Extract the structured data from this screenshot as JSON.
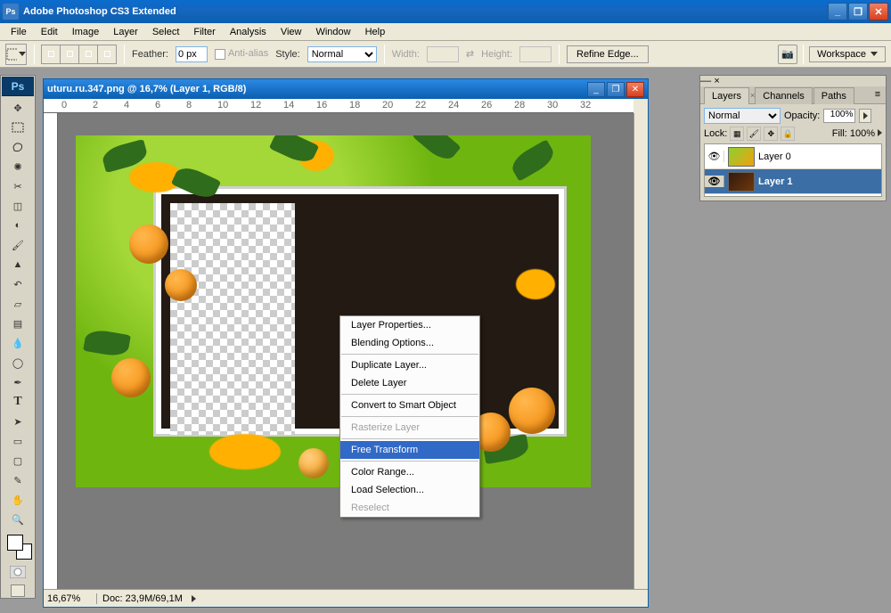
{
  "app": {
    "title": "Adobe Photoshop CS3 Extended"
  },
  "menu": [
    "File",
    "Edit",
    "Image",
    "Layer",
    "Select",
    "Filter",
    "Analysis",
    "View",
    "Window",
    "Help"
  ],
  "options": {
    "feather_label": "Feather:",
    "feather_value": "0 px",
    "antialias_label": "Anti-alias",
    "style_label": "Style:",
    "style_value": "Normal",
    "width_label": "Width:",
    "height_label": "Height:",
    "refine_label": "Refine Edge...",
    "workspace_label": "Workspace"
  },
  "document": {
    "title": "uturu.ru.347.png @ 16,7% (Layer 1, RGB/8)",
    "zoom": "16,67%",
    "docsize": "Doc: 23,9M/69,1M",
    "ruler_marks": [
      "0",
      "2",
      "4",
      "6",
      "8",
      "10",
      "12",
      "14",
      "16",
      "18",
      "20",
      "22",
      "24",
      "26",
      "28",
      "30",
      "32"
    ]
  },
  "context_menu": {
    "items": [
      {
        "label": "Layer Properties...",
        "enabled": true
      },
      {
        "label": "Blending Options...",
        "enabled": true
      },
      {
        "sep": true
      },
      {
        "label": "Duplicate Layer...",
        "enabled": true
      },
      {
        "label": "Delete Layer",
        "enabled": true
      },
      {
        "sep": true
      },
      {
        "label": "Convert to Smart Object",
        "enabled": true
      },
      {
        "sep": true
      },
      {
        "label": "Rasterize Layer",
        "enabled": false
      },
      {
        "sep": true
      },
      {
        "label": "Free Transform",
        "enabled": true,
        "selected": true
      },
      {
        "sep": true
      },
      {
        "label": "Color Range...",
        "enabled": true
      },
      {
        "label": "Load Selection...",
        "enabled": true
      },
      {
        "label": "Reselect",
        "enabled": false
      }
    ]
  },
  "layers_panel": {
    "tabs": [
      "Layers",
      "Channels",
      "Paths"
    ],
    "blend_mode": "Normal",
    "opacity_label": "Opacity:",
    "opacity_value": "100%",
    "lock_label": "Lock:",
    "fill_label": "Fill:",
    "fill_value": "100%",
    "layers": [
      {
        "name": "Layer 0",
        "visible": true,
        "selected": false
      },
      {
        "name": "Layer 1",
        "visible": true,
        "selected": true
      }
    ]
  },
  "toolbox_badge": "Ps"
}
